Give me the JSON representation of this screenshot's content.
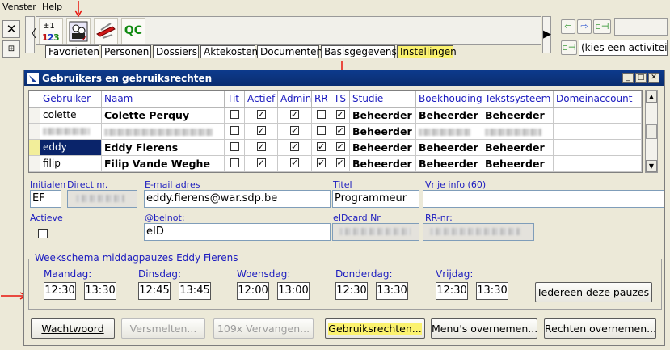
{
  "menu": {
    "items": [
      "Venster",
      "Help"
    ]
  },
  "toolbar": {
    "tools": [
      {
        "name": "calculator-123-icon",
        "text": "±1 2 3"
      },
      {
        "name": "user-rights-icon",
        "text": "👥"
      },
      {
        "name": "swiss-knife-icon",
        "text": "✂"
      },
      {
        "name": "qc-icon",
        "text": "QC"
      }
    ]
  },
  "tabs": [
    "Favorieten",
    "Personen",
    "Dossiers",
    "Aktekosten",
    "Documenten",
    "Basisgegevens",
    "Instellingen"
  ],
  "activity": {
    "value": "(kies een activiteit :)"
  },
  "window": {
    "title": "Gebruikers en gebruiksrechten"
  },
  "grid": {
    "columns": [
      "Gebruiker",
      "Naam",
      "Tit",
      "Actief",
      "Admin",
      "RR",
      "TS",
      "Studie",
      "Boekhouding",
      "Tekstsysteem",
      "Domeinaccount"
    ],
    "rows": [
      {
        "gebruiker": "colette",
        "naam": "Colette Perquy",
        "tit": false,
        "actief": true,
        "admin": true,
        "rr": false,
        "ts": true,
        "studie": "Beheerder",
        "boekhouding": "Beheerder",
        "tekstsysteem": "Beheerder",
        "selected": false,
        "blurred": false
      },
      {
        "gebruiker": "",
        "naam": "",
        "tit": false,
        "actief": true,
        "admin": true,
        "rr": false,
        "ts": true,
        "studie": "Beheerder",
        "boekhouding": "",
        "tekstsysteem": "",
        "selected": false,
        "blurred": true
      },
      {
        "gebruiker": "eddy",
        "naam": "Eddy Fierens",
        "tit": false,
        "actief": true,
        "admin": true,
        "rr": true,
        "ts": true,
        "studie": "Beheerder",
        "boekhouding": "Beheerder",
        "tekstsysteem": "Beheerder",
        "selected": true,
        "blurred": false
      },
      {
        "gebruiker": "filip",
        "naam": "Filip Vande Weghe",
        "tit": false,
        "actief": true,
        "admin": true,
        "rr": true,
        "ts": true,
        "studie": "Beheerder",
        "boekhouding": "Beheerder",
        "tekstsysteem": "Beheerder",
        "selected": false,
        "blurred": false
      }
    ]
  },
  "form": {
    "initialen_label": "Initialen",
    "initialen": "EF",
    "direct_label": "Direct nr.",
    "email_label": "E-mail adres",
    "email": "eddy.fierens@war.sdp.be",
    "titel_label": "Titel",
    "titel": "Programmeur",
    "vrije_label": "Vrije info (60)",
    "vrije": "",
    "actieve_label": "Actieve",
    "belnot_label": "@belnot:",
    "belnot": "eID",
    "eid_label": "eIDcard Nr",
    "rr_label": "RR-nr:"
  },
  "schedule": {
    "title": "Weekschema middagpauzes Eddy Fierens",
    "days": [
      {
        "label": "Maandag:",
        "from": "12:30",
        "to": "13:30"
      },
      {
        "label": "Dinsdag:",
        "from": "12:45",
        "to": "13:45"
      },
      {
        "label": "Woensdag:",
        "from": "12:00",
        "to": "13:00"
      },
      {
        "label": "Donderdag:",
        "from": "12:30",
        "to": "13:30"
      },
      {
        "label": "Vrijdag:",
        "from": "12:30",
        "to": "13:30"
      }
    ],
    "apply_all": "Iedereen deze pauzes"
  },
  "buttons": {
    "wachtwoord": "Wachtwoord",
    "versmelten": "Versmelten...",
    "vervangen": "109x Vervangen...",
    "gebruiksrechten": "Gebruiksrechten...",
    "menus": "Menu's overnemen...",
    "rechten": "Rechten overnemen..."
  },
  "colors": {
    "titlebar": "#0a2d6e",
    "highlight": "#fbf26f",
    "label": "#1b1bbf",
    "annotation": "#e8140c"
  }
}
